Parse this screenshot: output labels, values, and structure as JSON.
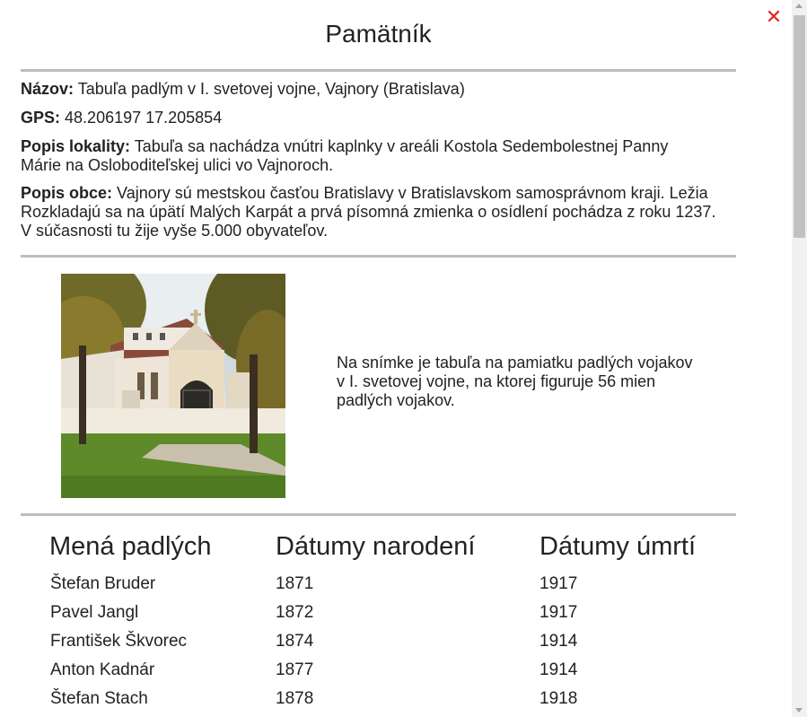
{
  "title": "Pamätník",
  "close_symbol": "✕",
  "info": {
    "name_label": "Názov:",
    "name_value": "Tabuľa padlým v I. svetovej vojne, Vajnory (Bratislava)",
    "gps_label": "GPS:",
    "gps_value": "48.206197 17.205854",
    "locality_label": "Popis lokality:",
    "locality_value": "Tabuľa sa nachádza vnútri kaplnky v areáli Kostola Sedembolestnej Panny Márie na Osloboditeľskej ulici vo Vajnoroch.",
    "village_label": "Popis obce:",
    "village_value": "Vajnory sú mestskou časťou Bratislavy v Bratislavskom samosprávnom kraji. Ležia Rozkladajú sa na úpätí Malých Karpát a prvá písomná zmienka o osídlení pochádza z roku 1237. V súčasnosti tu žije vyše 5.000 obyvateľov."
  },
  "photo": {
    "caption": "Na snímke je tabuľa na pamiatku padlých vojakov v I. svetovej vojne, na ktorej figuruje 56 mien padlých vojakov."
  },
  "table": {
    "headers": [
      "Mená padlých",
      "Dátumy narodení",
      "Dátumy úmrtí"
    ],
    "rows": [
      {
        "name": "Štefan Bruder",
        "born": "1871",
        "died": "1917"
      },
      {
        "name": "Pavel Jangl",
        "born": "1872",
        "died": "1917"
      },
      {
        "name": "František Škvorec",
        "born": "1874",
        "died": "1914"
      },
      {
        "name": "Anton Kadnár",
        "born": "1877",
        "died": "1914"
      },
      {
        "name": "Štefan Stach",
        "born": "1878",
        "died": "1918"
      }
    ]
  },
  "colors": {
    "close": "#e0241c",
    "rule": "#bdbdbd",
    "text": "#222222"
  }
}
